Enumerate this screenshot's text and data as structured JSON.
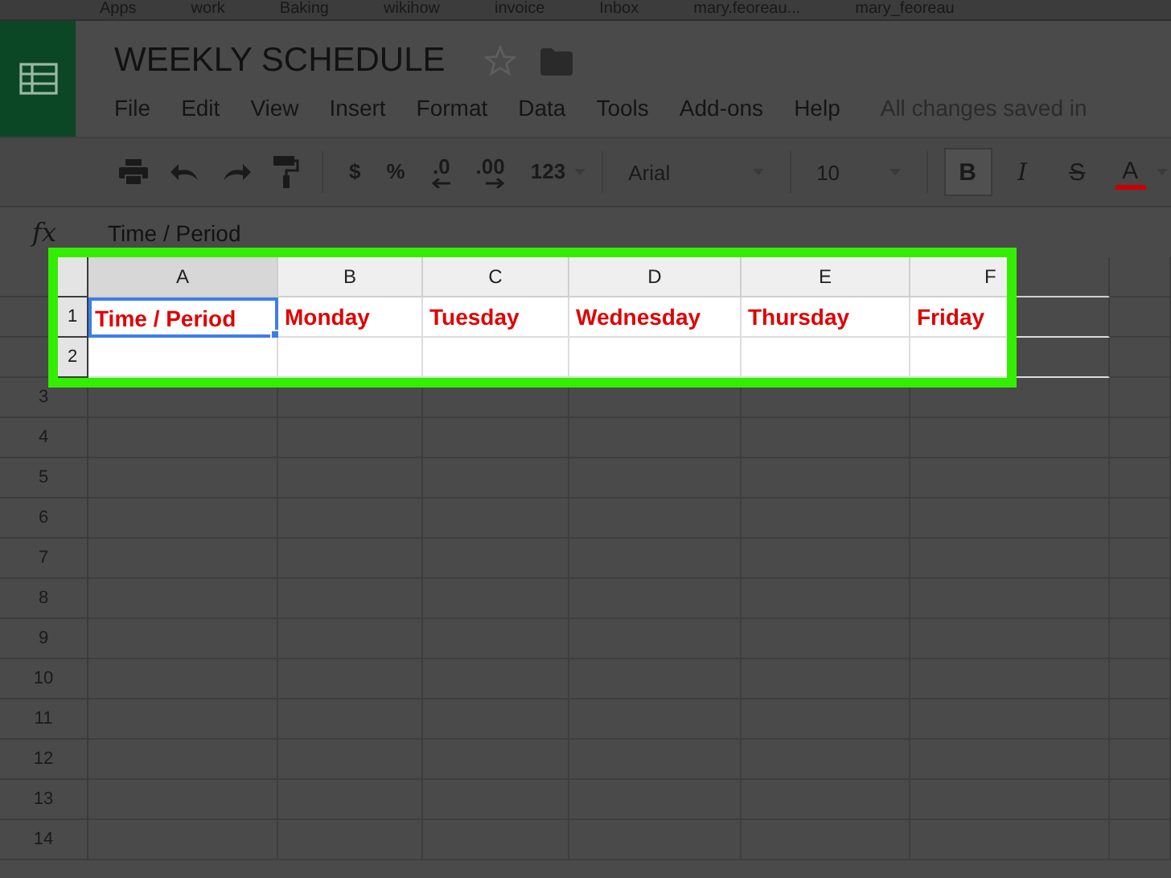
{
  "bookmarks": [
    "Apps",
    "work",
    "Baking",
    "wikihow",
    "invoice",
    "Inbox",
    "mary.feoreau...",
    "mary_feoreau"
  ],
  "document": {
    "title": "WEEKLY SCHEDULE",
    "starred": false
  },
  "menu": [
    "File",
    "Edit",
    "View",
    "Insert",
    "Format",
    "Data",
    "Tools",
    "Add-ons",
    "Help"
  ],
  "save_status": "All changes saved in",
  "toolbar": {
    "number_formats": [
      {
        "label": "$",
        "kind": "text"
      },
      {
        "label": "%",
        "kind": "text"
      },
      {
        "label": ".0",
        "kind": "decrease"
      },
      {
        "label": ".00",
        "kind": "increase"
      },
      {
        "label": "123",
        "kind": "menu"
      }
    ],
    "font": "Arial",
    "font_size": "10",
    "styles": [
      {
        "label": "B",
        "kind": "bold",
        "selected": true
      },
      {
        "label": "I",
        "kind": "italic",
        "selected": false
      },
      {
        "label": "S",
        "kind": "strike",
        "selected": false
      }
    ],
    "text_color": {
      "label": "A",
      "color": "#cc0000"
    }
  },
  "formula_bar": {
    "label": "fx",
    "value": "Time / Period"
  },
  "sheet": {
    "columns": [
      {
        "label": "A",
        "selected": true
      },
      {
        "label": "B",
        "selected": false
      },
      {
        "label": "C",
        "selected": false
      },
      {
        "label": "D",
        "selected": false
      },
      {
        "label": "E",
        "selected": false
      },
      {
        "label": "F",
        "selected": false
      }
    ],
    "header_row": [
      {
        "text": "Time / Period",
        "selected": true
      },
      {
        "text": "Monday",
        "selected": false
      },
      {
        "text": "Tuesday",
        "selected": false
      },
      {
        "text": "Wednesday",
        "selected": false
      },
      {
        "text": "Thursday",
        "selected": false
      },
      {
        "text": "Friday",
        "selected": false
      }
    ],
    "row_numbers": [
      "1",
      "2",
      "3",
      "4",
      "5",
      "6",
      "7",
      "8",
      "9",
      "10",
      "11",
      "12",
      "13",
      "14"
    ]
  }
}
